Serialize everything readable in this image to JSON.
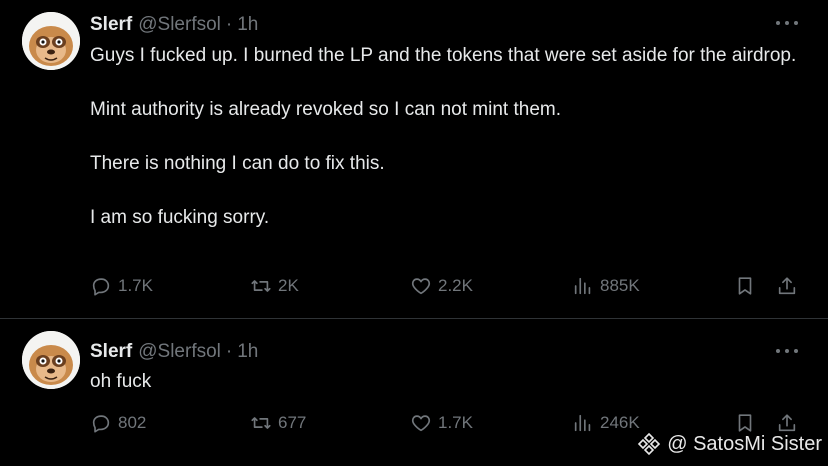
{
  "tweets": [
    {
      "name": "Slerf",
      "handle": "@Slerfsol",
      "dot": "·",
      "time": "1h",
      "avatar_icon": "sloth-avatar-icon",
      "paragraphs": [
        "Guys I fucked up. I burned the LP and the tokens that were set aside for the airdrop.",
        "Mint authority is already revoked so I can not mint them.",
        "There is nothing I can do to fix this.",
        "I am so fucking sorry."
      ],
      "replies": "1.7K",
      "reposts": "2K",
      "likes": "2.2K",
      "views": "885K"
    },
    {
      "name": "Slerf",
      "handle": "@Slerfsol",
      "dot": "·",
      "time": "1h",
      "avatar_icon": "sloth-avatar-icon",
      "paragraphs": [
        "oh fuck"
      ],
      "replies": "802",
      "reposts": "677",
      "likes": "1.7K",
      "views": "246K"
    }
  ],
  "icons": {
    "reply": "reply-icon",
    "repost": "repost-icon",
    "like": "heart-icon",
    "views": "views-chart-icon",
    "bookmark": "bookmark-icon",
    "share": "share-icon",
    "more": "more-dots-icon"
  },
  "colors": {
    "background": "#000000",
    "text": "#e7e9ea",
    "muted": "#71767b",
    "divider": "#2f3336"
  },
  "watermark": {
    "text": "@ SatosMi Sister",
    "icon": "binance-diamond-icon"
  }
}
